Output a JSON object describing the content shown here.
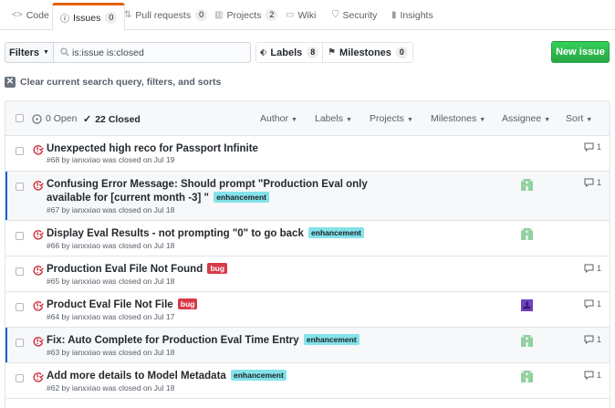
{
  "tabs": [
    {
      "icon": "code-icon",
      "glyph": "<>",
      "label": "Code",
      "count": null
    },
    {
      "icon": "issue-icon",
      "glyph": "ⓘ",
      "label": "Issues",
      "count": "0"
    },
    {
      "icon": "pull-request-icon",
      "glyph": "⇅",
      "label": "Pull requests",
      "count": "0"
    },
    {
      "icon": "project-icon",
      "glyph": "▥",
      "label": "Projects",
      "count": "2"
    },
    {
      "icon": "wiki-icon",
      "glyph": "▭",
      "label": "Wiki",
      "count": null
    },
    {
      "icon": "security-icon",
      "glyph": "⛉",
      "label": "Security",
      "count": null
    },
    {
      "icon": "insights-icon",
      "glyph": "▮",
      "label": "Insights",
      "count": null
    }
  ],
  "filters": {
    "button_label": "Filters",
    "search_value": "is:issue is:closed",
    "labels_label": "Labels",
    "labels_count": "8",
    "milestones_label": "Milestones",
    "milestones_count": "0",
    "new_issue_label": "New issue",
    "clear_query_label": "Clear current search query, filters, and sorts"
  },
  "list_header": {
    "open_label": "0 Open",
    "closed_label": "22 Closed",
    "menus": [
      "Author",
      "Labels",
      "Projects",
      "Milestones",
      "Assignee",
      "Sort"
    ]
  },
  "issues": [
    {
      "title": "Unexpected high reco for Passport Infinite",
      "labels": [],
      "meta": "#68 by ianxxiao was closed on Jul 19",
      "comments": "1",
      "assignee": null
    },
    {
      "title": "Confusing Error Message: Should prompt \"Production Eval only available for [current month -3] \"",
      "labels": [
        {
          "name": "enhancement",
          "type": "enh"
        }
      ],
      "meta": "#67 by ianxxiao was closed on Jul 18",
      "comments": "1",
      "assignee": "green"
    },
    {
      "title": "Display Eval Results - not prompting \"0\" to go back",
      "labels": [
        {
          "name": "enhancement",
          "type": "enh"
        }
      ],
      "meta": "#66 by ianxxiao was closed on Jul 18",
      "comments": null,
      "assignee": "green"
    },
    {
      "title": "Production Eval File Not Found",
      "labels": [
        {
          "name": "bug",
          "type": "bug"
        }
      ],
      "meta": "#65 by ianxxiao was closed on Jul 18",
      "comments": "1",
      "assignee": null
    },
    {
      "title": "Product Eval File Not File",
      "labels": [
        {
          "name": "bug",
          "type": "bug"
        }
      ],
      "meta": "#64 by ianxxiao was closed on Jul 17",
      "comments": "1",
      "assignee": "purple"
    },
    {
      "title": "Fix: Auto Complete for Production Eval Time Entry",
      "labels": [
        {
          "name": "enhancement",
          "type": "enh"
        }
      ],
      "meta": "#63 by ianxxiao was closed on Jul 18",
      "comments": "1",
      "assignee": "green"
    },
    {
      "title": "Add more details to Model Metadata",
      "labels": [
        {
          "name": "enhancement",
          "type": "enh"
        }
      ],
      "meta": "#62 by ianxxiao was closed on Jul 18",
      "comments": "1",
      "assignee": "green"
    }
  ],
  "colors": {
    "accent": "#e36209",
    "closed_icon": "#cb2431",
    "enhancement_label": "#84e2e9",
    "bug_label": "#d73a4a",
    "new_issue_button": "#28a745",
    "avatar_green": "#8fd19e",
    "avatar_purple": "#6f42c1"
  }
}
